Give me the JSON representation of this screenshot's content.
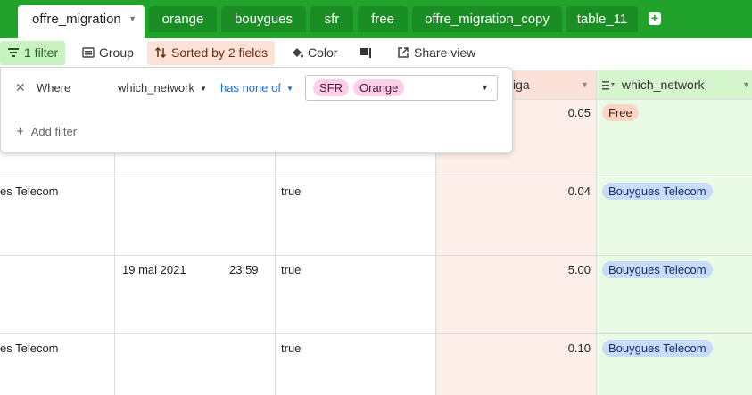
{
  "tabs": [
    {
      "label": "offre_migration",
      "active": true
    },
    {
      "label": "orange"
    },
    {
      "label": "bouygues"
    },
    {
      "label": "sfr"
    },
    {
      "label": "free"
    },
    {
      "label": "offre_migration_copy"
    },
    {
      "label": "table_11"
    }
  ],
  "toolbar": {
    "filter_label": "1 filter",
    "group_label": "Group",
    "sort_label": "Sorted by 2 fields",
    "color_label": "Color",
    "share_label": "Share view"
  },
  "columns": {
    "price_header_fragment": "iga",
    "network_header": "which_network"
  },
  "filter": {
    "where_label": "Where",
    "field": "which_network",
    "operator": "has none of",
    "values": [
      "SFR",
      "Orange"
    ],
    "add_label": "Add filter"
  },
  "rows": [
    {
      "name": "",
      "date": "",
      "time": "",
      "flag": "",
      "price": "0.05",
      "network": "Free"
    },
    {
      "name": "es Telecom",
      "date": "",
      "time": "",
      "flag": "true",
      "price": "0.04",
      "network": "Bouygues Telecom"
    },
    {
      "name": "",
      "date": "19 mai 2021",
      "time": "23:59",
      "flag": "true",
      "price": "5.00",
      "network": "Bouygues Telecom"
    },
    {
      "name": "es Telecom",
      "date": "",
      "time": "",
      "flag": "true",
      "price": "0.10",
      "network": "Bouygues Telecom"
    }
  ],
  "colors": {
    "tabbar": "#20a22b",
    "filter_active": "#c8f2c0",
    "sort_active": "#fde2d7",
    "price_column": "#fdeee9",
    "network_column": "#e9fbe5"
  }
}
